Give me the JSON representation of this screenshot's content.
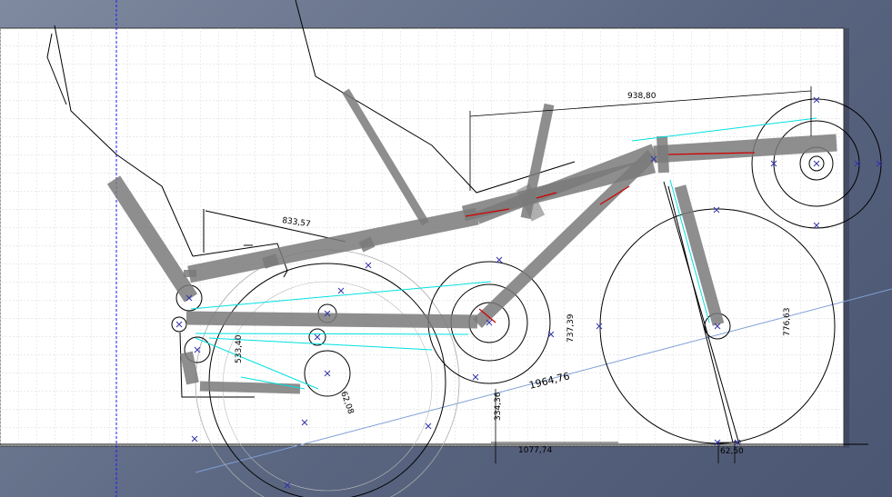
{
  "drawing": {
    "dimensions": {
      "top_span": "938,80",
      "seat_span": "833,57",
      "wheelbase": "1964,76",
      "ground_length": "1077,74",
      "trail": "62,50",
      "front_wheel_dia": "776,63",
      "mid_height": "737,39",
      "rear_height": "533,40",
      "bb_drop": "334,36",
      "chain_offset": "62,08"
    }
  },
  "colors": {
    "background": "#6b7590",
    "paper": "#ffffff",
    "grid": "#c8c8c8",
    "tube": "#7a7a7a",
    "chain_line": "#00e0e0",
    "construction_line": "#d00000",
    "axis_marker": "#3333aa",
    "reference_axis": "#1a1aff"
  }
}
